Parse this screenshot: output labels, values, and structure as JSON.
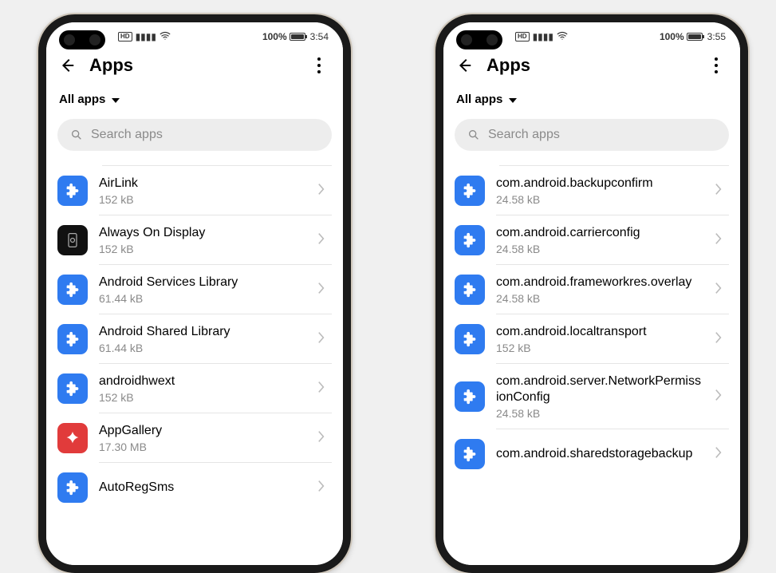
{
  "phones": [
    {
      "status": {
        "battery_pct": "100%",
        "time": "3:54"
      },
      "title": "Apps",
      "filter_label": "All apps",
      "search_placeholder": "Search apps",
      "apps": [
        {
          "name": "AirLink",
          "size": "152 kB",
          "icon": "puzzle"
        },
        {
          "name": "Always On Display",
          "size": "152 kB",
          "icon": "aod"
        },
        {
          "name": "Android Services Library",
          "size": "61.44 kB",
          "icon": "puzzle"
        },
        {
          "name": "Android Shared Library",
          "size": "61.44 kB",
          "icon": "puzzle"
        },
        {
          "name": "androidhwext",
          "size": "152 kB",
          "icon": "puzzle"
        },
        {
          "name": "AppGallery",
          "size": "17.30 MB",
          "icon": "huawei"
        },
        {
          "name": "AutoRegSms",
          "size": "",
          "icon": "puzzle"
        }
      ]
    },
    {
      "status": {
        "battery_pct": "100%",
        "time": "3:55"
      },
      "title": "Apps",
      "filter_label": "All apps",
      "search_placeholder": "Search apps",
      "apps": [
        {
          "name": "com.android.backupconfirm",
          "size": "24.58 kB",
          "icon": "puzzle"
        },
        {
          "name": "com.android.carrierconfig",
          "size": "24.58 kB",
          "icon": "puzzle"
        },
        {
          "name": "com.android.frameworkres.overlay",
          "size": "24.58 kB",
          "icon": "puzzle"
        },
        {
          "name": "com.android.localtransport",
          "size": "152 kB",
          "icon": "puzzle"
        },
        {
          "name": "com.android.server.NetworkPermissionConfig",
          "size": "24.58 kB",
          "icon": "puzzle"
        },
        {
          "name": "com.android.sharedstoragebackup",
          "size": "",
          "icon": "puzzle"
        }
      ]
    }
  ]
}
